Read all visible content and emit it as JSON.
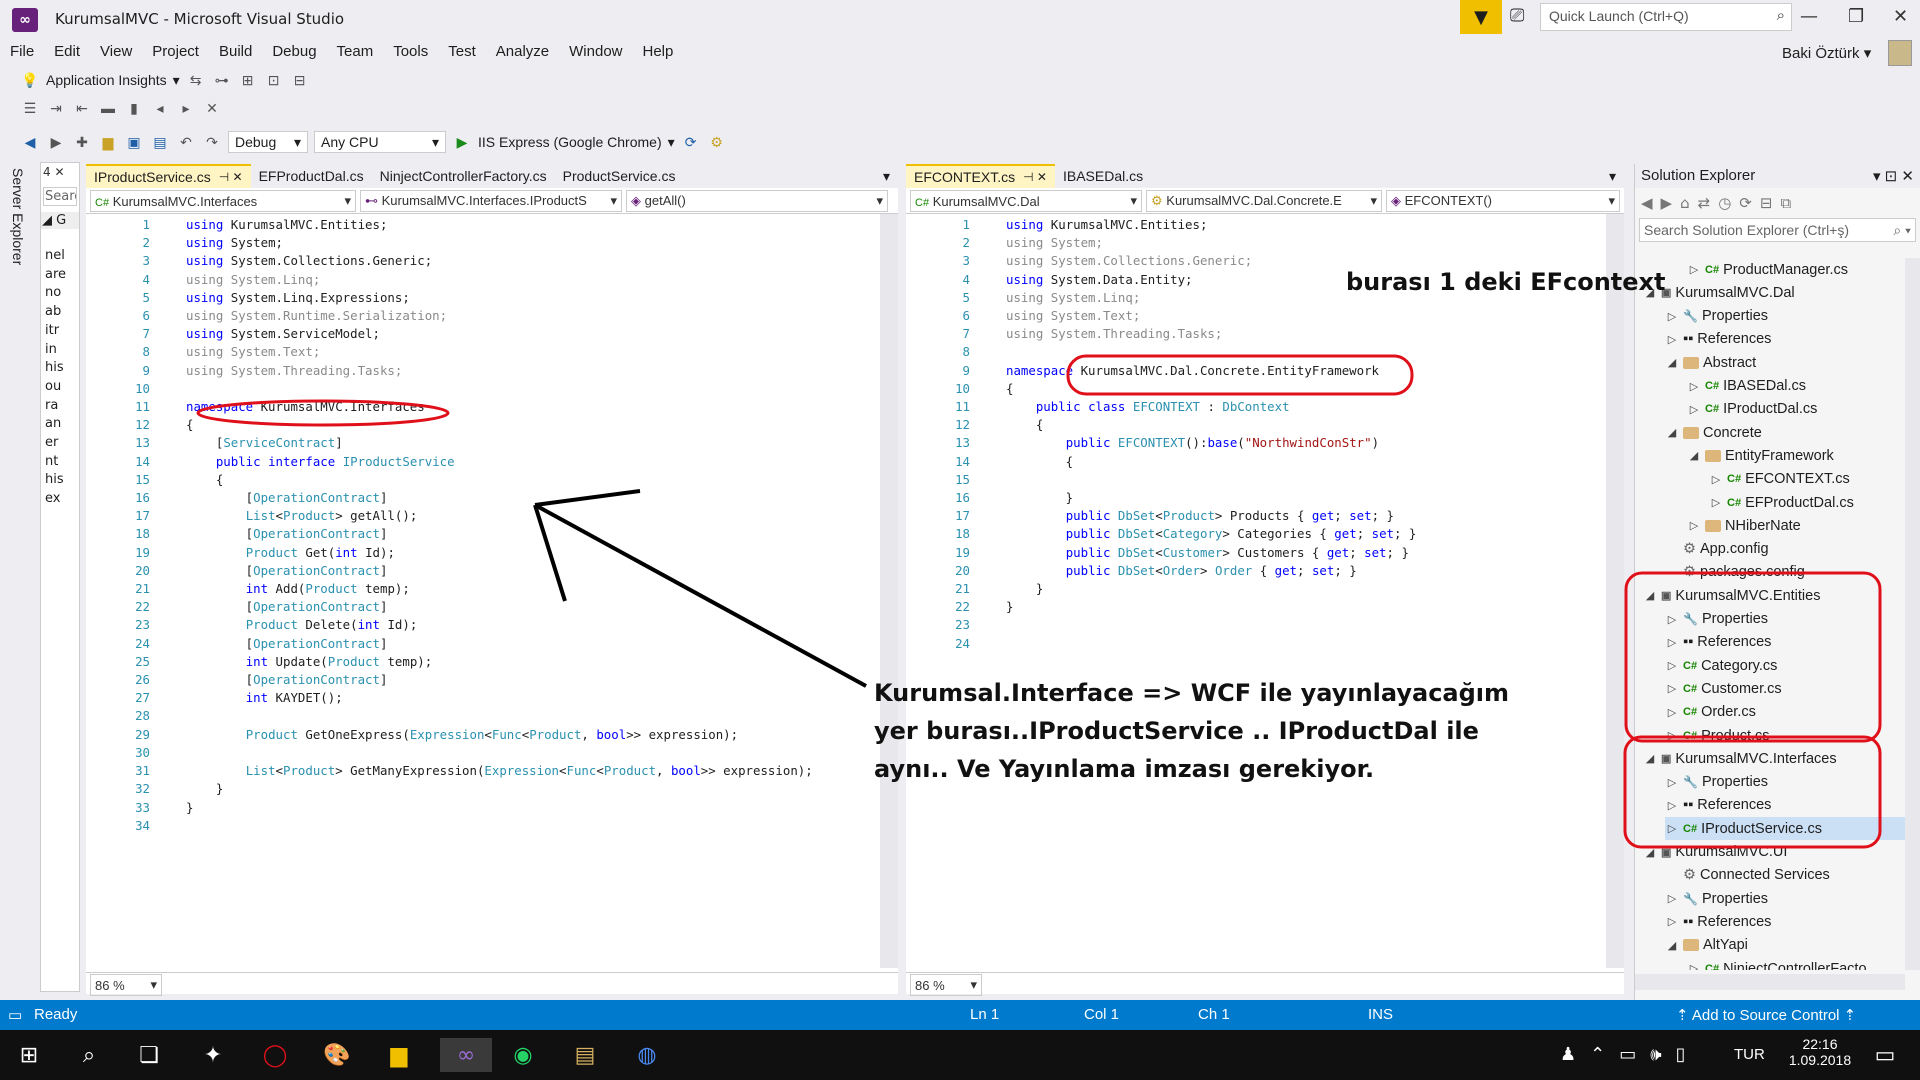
{
  "window": {
    "title": "KurumsalMVC - Microsoft Visual Studio",
    "quick_launch_placeholder": "Quick Launch (Ctrl+Q)",
    "user": "Baki Öztürk"
  },
  "menu": [
    "File",
    "Edit",
    "View",
    "Project",
    "Build",
    "Debug",
    "Team",
    "Tools",
    "Test",
    "Analyze",
    "Window",
    "Help"
  ],
  "toolbar": {
    "insights": "Application Insights",
    "config": "Debug",
    "platform": "Any CPU",
    "run": "IIS Express (Google Chrome)"
  },
  "left_tool": {
    "server_explorer": "Server Explorer",
    "search": "Searc",
    "g": "G",
    "fragments": [
      "nel",
      "are",
      "no",
      "ab",
      "itr",
      "in",
      "his",
      "ou",
      "ra",
      "an",
      "er",
      "nt",
      "his",
      "ex"
    ]
  },
  "editor_left": {
    "tabs": [
      "IProductService.cs",
      "EFProductDal.cs",
      "NinjectControllerFactory.cs",
      "ProductService.cs"
    ],
    "nav": [
      "KurumsalMVC.Interfaces",
      "KurumsalMVC.Interfaces.IProductS",
      "getAll()"
    ],
    "zoom": "86 %",
    "lines": [
      "using KurumsalMVC.Entities;",
      "using System;",
      "using System.Collections.Generic;",
      "using System.Linq;",
      "using System.Linq.Expressions;",
      "using System.Runtime.Serialization;",
      "using System.ServiceModel;",
      "using System.Text;",
      "using System.Threading.Tasks;",
      "",
      "namespace KurumsalMVC.Interfaces",
      "{",
      "    [ServiceContract]",
      "    public interface IProductService",
      "    {",
      "        [OperationContract]",
      "        List<Product> getAll();",
      "        [OperationContract]",
      "        Product Get(int Id);",
      "        [OperationContract]",
      "        int Add(Product temp);",
      "        [OperationContract]",
      "        Product Delete(int Id);",
      "        [OperationContract]",
      "        int Update(Product temp);",
      "        [OperationContract]",
      "        int KAYDET();",
      "",
      "        Product GetOneExpress(Expression<Func<Product, bool>> expression);",
      "",
      "        List<Product> GetManyExpression(Expression<Func<Product, bool>> expression);",
      "    }",
      "}",
      ""
    ]
  },
  "editor_right": {
    "tabs": [
      "EFCONTEXT.cs",
      "IBASEDal.cs"
    ],
    "nav": [
      "KurumsalMVC.Dal",
      "KurumsalMVC.Dal.Concrete.E",
      "EFCONTEXT()"
    ],
    "zoom": "86 %",
    "lines": [
      "using KurumsalMVC.Entities;",
      "using System;",
      "using System.Collections.Generic;",
      "using System.Data.Entity;",
      "using System.Linq;",
      "using System.Text;",
      "using System.Threading.Tasks;",
      "",
      "namespace KurumsalMVC.Dal.Concrete.EntityFramework",
      "{",
      "    public class EFCONTEXT : DbContext",
      "    {",
      "        public EFCONTEXT():base(\"NorthwindConStr\")",
      "        {",
      "",
      "        }",
      "        public DbSet<Product> Products { get; set; }",
      "        public DbSet<Category> Categories { get; set; }",
      "        public DbSet<Customer> Customers { get; set; }",
      "        public DbSet<Order> Order { get; set; }",
      "    }",
      "}",
      "",
      ""
    ]
  },
  "solution_explorer": {
    "title": "Solution Explorer",
    "search": "Search Solution Explorer (Ctrl+ş)",
    "items": [
      {
        "label": "ProductManager.cs",
        "kind": "cs",
        "indent": 2,
        "exp": "▷"
      },
      {
        "label": "KurumsalMVC.Dal",
        "kind": "proj",
        "indent": 0,
        "exp": "◢"
      },
      {
        "label": "Properties",
        "kind": "wrench",
        "indent": 1,
        "exp": "▷"
      },
      {
        "label": "References",
        "kind": "ref",
        "indent": 1,
        "exp": "▷"
      },
      {
        "label": "Abstract",
        "kind": "folder",
        "indent": 1,
        "exp": "◢"
      },
      {
        "label": "IBASEDal.cs",
        "kind": "cs",
        "indent": 2,
        "exp": "▷"
      },
      {
        "label": "IProductDal.cs",
        "kind": "cs",
        "indent": 2,
        "exp": "▷"
      },
      {
        "label": "Concrete",
        "kind": "folder",
        "indent": 1,
        "exp": "◢"
      },
      {
        "label": "EntityFramework",
        "kind": "folder",
        "indent": 2,
        "exp": "◢"
      },
      {
        "label": "EFCONTEXT.cs",
        "kind": "cs",
        "indent": 3,
        "exp": "▷"
      },
      {
        "label": "EFProductDal.cs",
        "kind": "cs",
        "indent": 3,
        "exp": "▷"
      },
      {
        "label": "NHiberNate",
        "kind": "folder",
        "indent": 2,
        "exp": "▷"
      },
      {
        "label": "App.config",
        "kind": "cfg",
        "indent": 1,
        "exp": ""
      },
      {
        "label": "packages.config",
        "kind": "cfg",
        "indent": 1,
        "exp": ""
      },
      {
        "label": "KurumsalMVC.Entities",
        "kind": "proj",
        "indent": 0,
        "exp": "◢"
      },
      {
        "label": "Properties",
        "kind": "wrench",
        "indent": 1,
        "exp": "▷"
      },
      {
        "label": "References",
        "kind": "ref",
        "indent": 1,
        "exp": "▷"
      },
      {
        "label": "Category.cs",
        "kind": "cs",
        "indent": 1,
        "exp": "▷"
      },
      {
        "label": "Customer.cs",
        "kind": "cs",
        "indent": 1,
        "exp": "▷"
      },
      {
        "label": "Order.cs",
        "kind": "cs",
        "indent": 1,
        "exp": "▷"
      },
      {
        "label": "Product.cs",
        "kind": "cs",
        "indent": 1,
        "exp": "▷"
      },
      {
        "label": "KurumsalMVC.Interfaces",
        "kind": "proj",
        "indent": 0,
        "exp": "◢"
      },
      {
        "label": "Properties",
        "kind": "wrench",
        "indent": 1,
        "exp": "▷"
      },
      {
        "label": "References",
        "kind": "ref",
        "indent": 1,
        "exp": "▷"
      },
      {
        "label": "IProductService.cs",
        "kind": "cs",
        "indent": 1,
        "exp": "▷",
        "selected": true
      },
      {
        "label": "KurumsalMVC.UI",
        "kind": "proj",
        "indent": 0,
        "exp": "◢"
      },
      {
        "label": "Connected Services",
        "kind": "cfg",
        "indent": 1,
        "exp": ""
      },
      {
        "label": "Properties",
        "kind": "wrench",
        "indent": 1,
        "exp": "▷"
      },
      {
        "label": "References",
        "kind": "ref",
        "indent": 1,
        "exp": "▷"
      },
      {
        "label": "AltYapi",
        "kind": "folder",
        "indent": 1,
        "exp": "◢"
      },
      {
        "label": "NinjectControllerFacto",
        "kind": "cs",
        "indent": 2,
        "exp": "▷"
      }
    ]
  },
  "annotations": {
    "efcontext": "burası 1 deki EFcontext",
    "interface": [
      "Kurumsal.Interface => WCF ile yayınlayacağım",
      "yer burası..IProductService .. IProductDal ile",
      "aynı.. Ve Yayınlama imzası gerekiyor."
    ]
  },
  "status": {
    "ready": "Ready",
    "ln": "Ln 1",
    "col": "Col 1",
    "ch": "Ch 1",
    "ins": "INS",
    "source_control": "Add to Source Control"
  },
  "taskbar": {
    "time": "22:16",
    "date": "1.09.2018",
    "lang": "TUR"
  },
  "colors": {
    "accent": "#007acc",
    "tab_active": "#fff4c4",
    "annotation": "#e0101a"
  }
}
